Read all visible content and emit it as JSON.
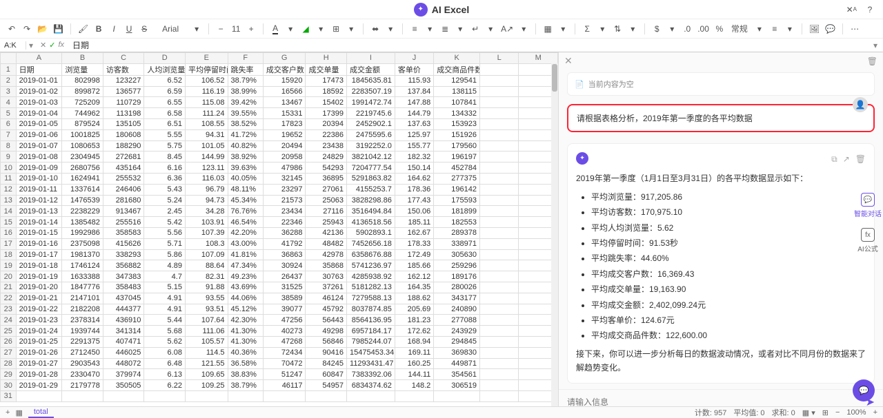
{
  "app": {
    "title": "AI Excel"
  },
  "toolbar": {
    "font_name": "Arial",
    "font_size": "11",
    "number_format": "常规"
  },
  "formula_bar": {
    "name_box": "A:K",
    "value": "日期"
  },
  "columns": [
    "A",
    "B",
    "C",
    "D",
    "E",
    "F",
    "G",
    "H",
    "I",
    "J",
    "K",
    "L",
    "M"
  ],
  "headers": [
    "日期",
    "浏览量",
    "访客数",
    "人均浏览量",
    "平均停留时间",
    "跳失率",
    "成交客户数",
    "成交单量",
    "成交金额",
    "客单价",
    "成交商品件数"
  ],
  "rows": [
    [
      "2019-01-01",
      "802998",
      "123227",
      "6.52",
      "106.52",
      "38.79%",
      "15920",
      "17473",
      "1845635.81",
      "115.93",
      "129541"
    ],
    [
      "2019-01-02",
      "899872",
      "136577",
      "6.59",
      "116.19",
      "38.99%",
      "16566",
      "18592",
      "2283507.19",
      "137.84",
      "138115"
    ],
    [
      "2019-01-03",
      "725209",
      "110729",
      "6.55",
      "115.08",
      "39.42%",
      "13467",
      "15402",
      "1991472.74",
      "147.88",
      "107841"
    ],
    [
      "2019-01-04",
      "744962",
      "113198",
      "6.58",
      "111.24",
      "39.55%",
      "15331",
      "17399",
      "2219745.6",
      "144.79",
      "134332"
    ],
    [
      "2019-01-05",
      "879524",
      "135105",
      "6.51",
      "108.55",
      "38.52%",
      "17823",
      "20394",
      "2452902.1",
      "137.63",
      "153923"
    ],
    [
      "2019-01-06",
      "1001825",
      "180608",
      "5.55",
      "94.31",
      "41.72%",
      "19652",
      "22386",
      "2475595.6",
      "125.97",
      "151926"
    ],
    [
      "2019-01-07",
      "1080653",
      "188290",
      "5.75",
      "101.05",
      "40.82%",
      "20494",
      "23438",
      "3192252.0",
      "155.77",
      "179560"
    ],
    [
      "2019-01-08",
      "2304945",
      "272681",
      "8.45",
      "144.99",
      "38.92%",
      "20958",
      "24829",
      "3821042.12",
      "182.32",
      "196197"
    ],
    [
      "2019-01-09",
      "2680756",
      "435164",
      "6.16",
      "123.11",
      "39.63%",
      "47986",
      "54293",
      "7204777.54",
      "150.14",
      "452784"
    ],
    [
      "2019-01-10",
      "1624941",
      "255532",
      "6.36",
      "116.03",
      "40.05%",
      "32145",
      "36895",
      "5291863.82",
      "164.62",
      "277375"
    ],
    [
      "2019-01-11",
      "1337614",
      "246406",
      "5.43",
      "96.79",
      "48.11%",
      "23297",
      "27061",
      "4155253.7",
      "178.36",
      "196142"
    ],
    [
      "2019-01-12",
      "1476539",
      "281680",
      "5.24",
      "94.73",
      "45.34%",
      "21573",
      "25063",
      "3828298.86",
      "177.43",
      "175593"
    ],
    [
      "2019-01-13",
      "2238229",
      "913467",
      "2.45",
      "34.28",
      "76.76%",
      "23434",
      "27116",
      "3516494.84",
      "150.06",
      "181899"
    ],
    [
      "2019-01-14",
      "1385482",
      "255516",
      "5.42",
      "103.91",
      "46.54%",
      "22346",
      "25943",
      "4136518.56",
      "185.11",
      "182553"
    ],
    [
      "2019-01-15",
      "1992986",
      "358583",
      "5.56",
      "107.39",
      "42.20%",
      "36288",
      "42136",
      "5902893.1",
      "162.67",
      "289378"
    ],
    [
      "2019-01-16",
      "2375098",
      "415626",
      "5.71",
      "108.3",
      "43.00%",
      "41792",
      "48482",
      "7452656.18",
      "178.33",
      "338971"
    ],
    [
      "2019-01-17",
      "1981370",
      "338293",
      "5.86",
      "107.09",
      "41.81%",
      "36863",
      "42978",
      "6358676.88",
      "172.49",
      "305630"
    ],
    [
      "2019-01-18",
      "1746124",
      "356882",
      "4.89",
      "88.64",
      "47.34%",
      "30924",
      "35868",
      "5741236.97",
      "185.66",
      "259296"
    ],
    [
      "2019-01-19",
      "1633388",
      "347383",
      "4.7",
      "82.31",
      "49.23%",
      "26437",
      "30763",
      "4285938.92",
      "162.12",
      "189176"
    ],
    [
      "2019-01-20",
      "1847776",
      "358483",
      "5.15",
      "91.88",
      "43.69%",
      "31525",
      "37261",
      "5181282.13",
      "164.35",
      "280026"
    ],
    [
      "2019-01-21",
      "2147101",
      "437045",
      "4.91",
      "93.55",
      "44.06%",
      "38589",
      "46124",
      "7279588.13",
      "188.62",
      "343177"
    ],
    [
      "2019-01-22",
      "2182208",
      "444377",
      "4.91",
      "93.51",
      "45.12%",
      "39077",
      "45792",
      "8037874.85",
      "205.69",
      "240890"
    ],
    [
      "2019-01-23",
      "2378314",
      "436910",
      "5.44",
      "107.64",
      "42.30%",
      "47256",
      "56443",
      "8564136.95",
      "181.23",
      "277088"
    ],
    [
      "2019-01-24",
      "1939744",
      "341314",
      "5.68",
      "111.06",
      "41.30%",
      "40273",
      "49298",
      "6957184.17",
      "172.62",
      "243929"
    ],
    [
      "2019-01-25",
      "2291375",
      "407471",
      "5.62",
      "105.57",
      "41.30%",
      "47268",
      "56846",
      "7985244.07",
      "168.94",
      "294845"
    ],
    [
      "2019-01-26",
      "2712450",
      "446025",
      "6.08",
      "114.5",
      "40.36%",
      "72434",
      "90416",
      "15475453.34",
      "169.11",
      "369830"
    ],
    [
      "2019-01-27",
      "2903543",
      "448072",
      "6.48",
      "121.55",
      "36.58%",
      "70472",
      "84245",
      "11293431.47",
      "160.25",
      "449871"
    ],
    [
      "2019-01-28",
      "2330470",
      "379974",
      "6.13",
      "109.65",
      "38.83%",
      "51247",
      "60847",
      "7383392.06",
      "144.11",
      "354561"
    ],
    [
      "2019-01-29",
      "2179778",
      "350505",
      "6.22",
      "109.25",
      "38.79%",
      "46117",
      "54957",
      "6834374.62",
      "148.2",
      "306519"
    ]
  ],
  "ai_panel": {
    "empty_notice": "当前内容为空",
    "user_question": "请根据表格分析，2019年第一季度的各平均数据",
    "response_intro": "2019年第一季度（1月1日至3月31日）的各平均数据显示如下：",
    "averages": [
      "平均浏览量：917,205.86",
      "平均访客数：170,975.10",
      "平均人均浏览量：5.62",
      "平均停留时间：91.53秒",
      "平均跳失率：44.60%",
      "平均成交客户数：16,369.43",
      "平均成交单量：19,163.90",
      "平均成交金额：2,402,099.24元",
      "平均客单价：124.67元",
      "平均成交商品件数：122,600.00"
    ],
    "response_outro": "接下来，你可以进一步分析每日的数据波动情况，或者对比不同月份的数据来了解趋势变化。",
    "input_placeholder": "请输入信息"
  },
  "side_tabs": {
    "chat": "智能对话",
    "formula": "AI公式"
  },
  "status_bar": {
    "tab_label": "total",
    "count_label": "计数: 957",
    "avg_label": "平均值: 0",
    "sum_label": "求和: 0",
    "zoom": "100%"
  },
  "chart_data": null
}
